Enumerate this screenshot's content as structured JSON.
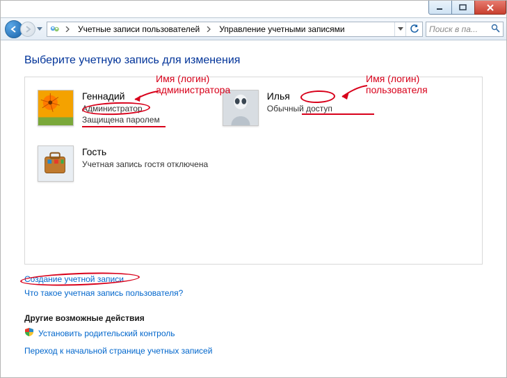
{
  "breadcrumb": {
    "seg1": "Учетные записи пользователей",
    "seg2": "Управление учетными записями"
  },
  "search": {
    "placeholder": "Поиск в па..."
  },
  "page_title": "Выберите учетную запись для изменения",
  "accounts": {
    "admin": {
      "name": "Геннадий",
      "role": "Администратор",
      "status": "Защищена паролем"
    },
    "user": {
      "name": "Илья",
      "role": "Обычный доступ"
    },
    "guest": {
      "name": "Гость",
      "status": "Учетная запись гостя отключена"
    }
  },
  "links": {
    "create": "Создание учетной записи",
    "what_is": "Что такое учетная запись пользователя?",
    "other_head": "Другие возможные действия",
    "parental": "Установить родительский контроль",
    "go_home": "Переход к начальной странице учетных записей"
  },
  "annotations": {
    "admin_login": "Имя (логин)\nадминистратора",
    "user_login": "Имя (логин)\nпользователя"
  }
}
